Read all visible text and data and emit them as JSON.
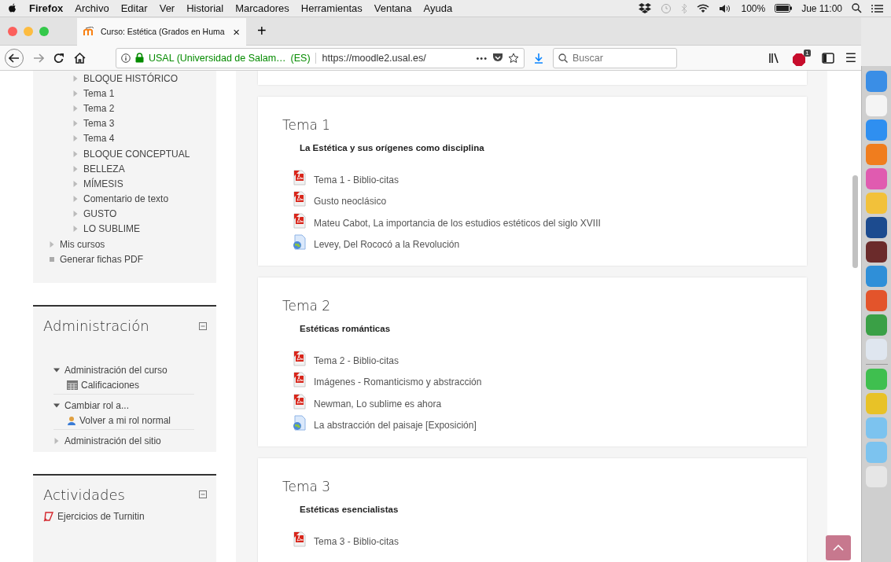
{
  "menubar": {
    "app": "Firefox",
    "menus": [
      "Archivo",
      "Editar",
      "Ver",
      "Historial",
      "Marcadores",
      "Herramientas",
      "Ventana",
      "Ayuda"
    ],
    "battery": "100%",
    "clock": "Jue 11:00"
  },
  "tab": {
    "title": "Curso: Estética (Grados en Huma",
    "close": "×"
  },
  "new_tab": "+",
  "toolbar": {
    "identity": "USAL (Universidad de Salam…",
    "country": "(ES)",
    "url": "https://moodle2.usal.es/",
    "more": "•••",
    "search_placeholder": "Buscar",
    "addon_badge": "1",
    "menu": "☰"
  },
  "navigation": {
    "sections": [
      "BLOQUE HISTÓRICO",
      "Tema 1",
      "Tema 2",
      "Tema 3",
      "Tema 4",
      "BLOQUE CONCEPTUAL",
      "BELLEZA",
      "MÍMESIS",
      "Comentario de texto",
      "GUSTO",
      "LO SUBLIME"
    ],
    "items": [
      {
        "label": "Mis cursos",
        "kind": "branch"
      },
      {
        "label": "Generar fichas PDF",
        "kind": "leaf"
      }
    ]
  },
  "administration": {
    "title": "Administración",
    "items": [
      {
        "label": "Administración del curso",
        "expanded": true,
        "children": [
          {
            "label": "Calificaciones",
            "kind": "grades"
          }
        ]
      },
      {
        "label": "Cambiar rol a...",
        "expanded": true,
        "children": [
          {
            "label": "Volver a mi rol normal",
            "kind": "user"
          }
        ]
      },
      {
        "label": "Administración del sitio",
        "expanded": false
      }
    ]
  },
  "activities": {
    "title": "Actividades",
    "items": [
      {
        "label": "Ejercicios de Turnitin"
      }
    ]
  },
  "sections": [
    {
      "title": "Tema 1",
      "summary": "La Estética y sus orígenes como disciplina",
      "resources": [
        {
          "label": "Tema 1 - Biblio-citas",
          "kind": "pdf"
        },
        {
          "label": "Gusto neoclásico",
          "kind": "pdf"
        },
        {
          "label": "Mateu Cabot, La importancia de los estudios estéticos del siglo XVIII",
          "kind": "pdf"
        },
        {
          "label": "Levey, Del Rococó a la Revolución",
          "kind": "url"
        }
      ]
    },
    {
      "title": "Tema 2",
      "summary": "Estéticas románticas",
      "resources": [
        {
          "label": "Tema 2 - Biblio-citas",
          "kind": "pdf"
        },
        {
          "label": "Imágenes - Romanticismo y abstracción",
          "kind": "pdf"
        },
        {
          "label": "Newman, Lo sublime es ahora",
          "kind": "pdf"
        },
        {
          "label": "La abstracción del paisaje [Exposición]",
          "kind": "url"
        }
      ]
    },
    {
      "title": "Tema 3",
      "summary": "Estéticas esencialistas",
      "resources": [
        {
          "label": "Tema 3 - Biblio-citas",
          "kind": "pdf"
        }
      ]
    }
  ]
}
